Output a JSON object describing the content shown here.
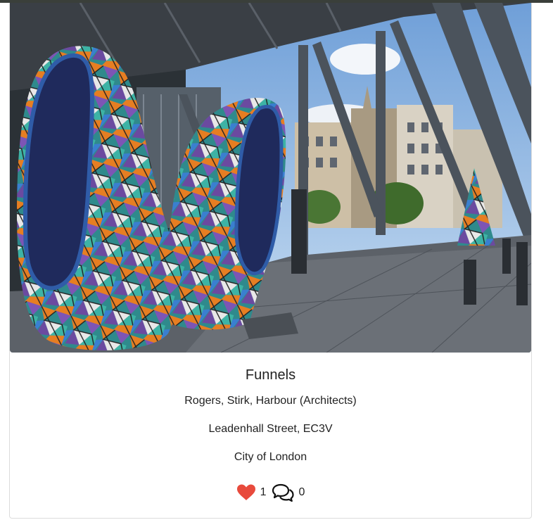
{
  "card": {
    "title": "Funnels",
    "architects": "Rogers, Stirk, Harbour (Architects)",
    "address": "Leadenhall Street, EC3V",
    "borough": "City of London"
  },
  "stats": {
    "likes": "1",
    "comments": "0",
    "like_icon": "heart-icon",
    "comment_icon": "speech-bubbles-icon",
    "like_color": "#e84a3c"
  },
  "photo": {
    "subject": "mosaic-funnel-sculpture"
  }
}
